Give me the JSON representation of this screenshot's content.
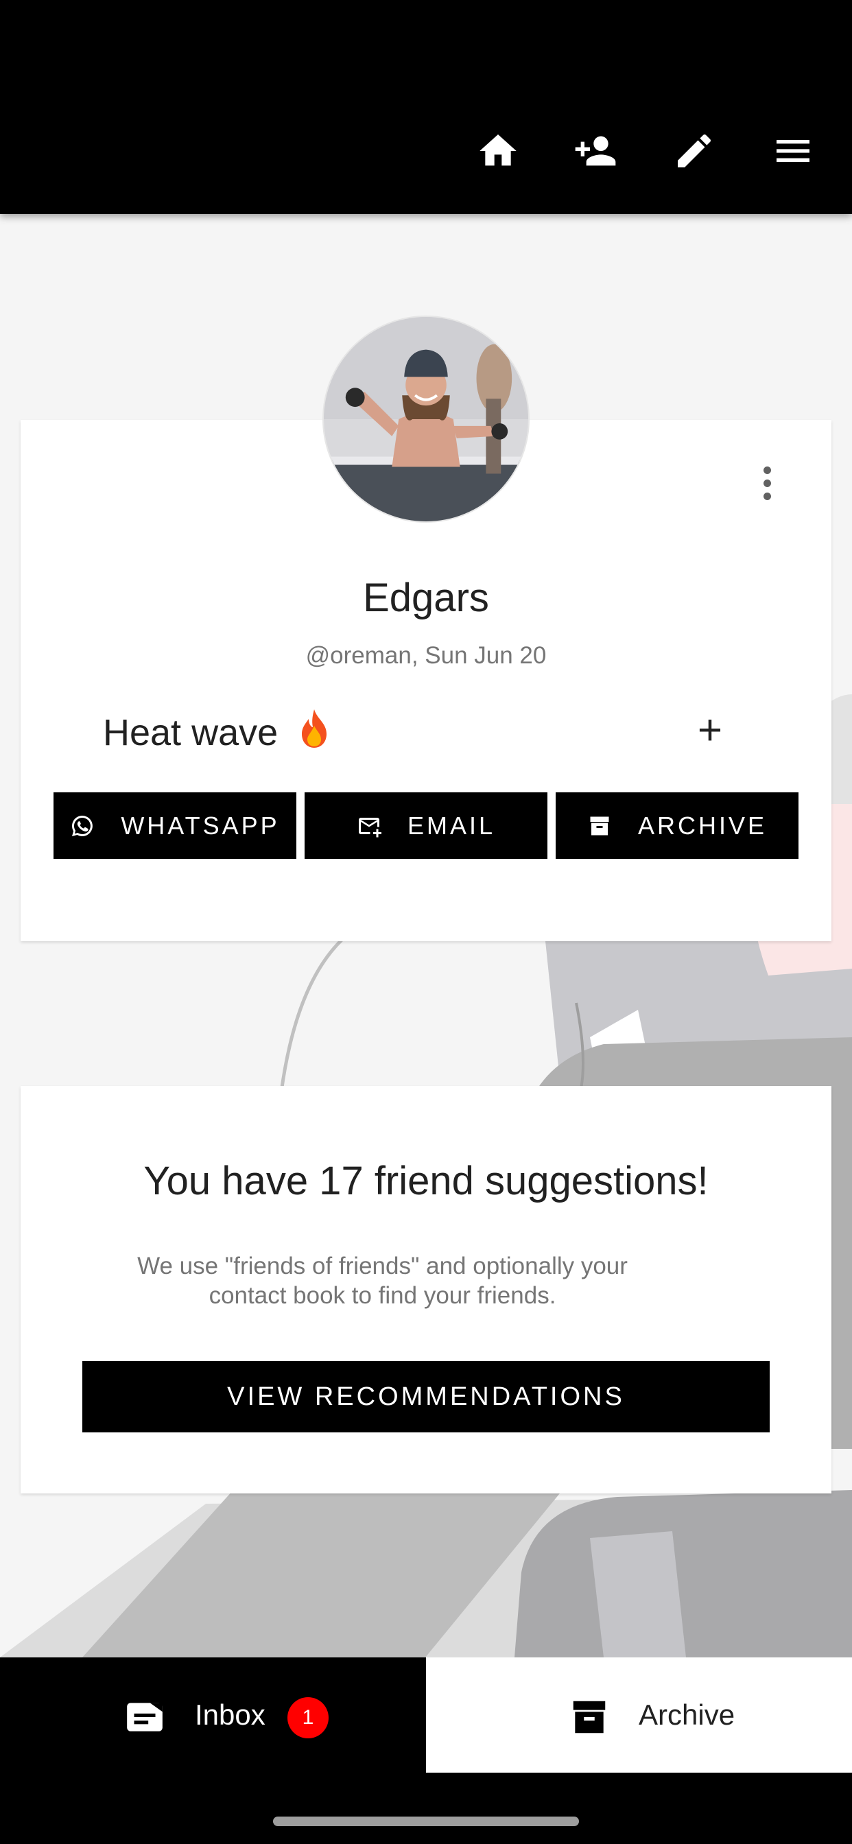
{
  "topbar": {
    "icons": [
      "home-icon",
      "add-person-icon",
      "pencil-icon",
      "menu-icon"
    ]
  },
  "profile": {
    "name": "Edgars",
    "meta": "@oreman, Sun Jun 20",
    "status": "Heat wave",
    "status_emoji": "fire-icon",
    "add_label": "+",
    "actions": {
      "whatsapp": "WHATSAPP",
      "email": "EMAIL",
      "archive": "ARCHIVE"
    }
  },
  "suggestions": {
    "title": "You have 17 friend suggestions!",
    "description": "We use \"friends of friends\" and optionally your contact book to find your friends.",
    "button": "VIEW RECOMMENDATIONS"
  },
  "bottom_nav": {
    "inbox_label": "Inbox",
    "inbox_badge": "1",
    "archive_label": "Archive",
    "active": "archive"
  },
  "colors": {
    "bar": "#000000",
    "background": "#f5f5f5",
    "badge": "#ff0000",
    "secondary_text": "#757575"
  }
}
